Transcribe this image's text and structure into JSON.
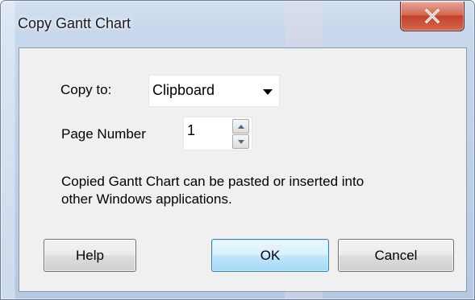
{
  "window": {
    "title": "Copy Gantt Chart",
    "close_label": "X"
  },
  "copy_to": {
    "label": "Copy to:",
    "selected": "Clipboard"
  },
  "page_number": {
    "label": "Page Number",
    "value": "1"
  },
  "description": {
    "line1": "Copied Gantt Chart can be pasted or inserted into",
    "line2": "other Windows applications."
  },
  "buttons": {
    "help": "Help",
    "ok": "OK",
    "cancel": "Cancel"
  },
  "colors": {
    "frame": "#b9cde6",
    "close_button": "#c94a32",
    "default_button_border": "#3c7fb1"
  }
}
